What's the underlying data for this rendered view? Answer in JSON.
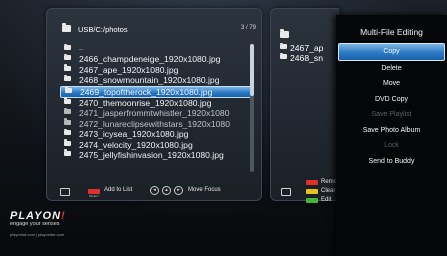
{
  "browser": {
    "path": "USB/C:/photos",
    "page_count": "3 / 79",
    "up_label": "..",
    "files": [
      "2466_champdeneige_1920x1080.jpg",
      "2467_ape_1920x1080.jpg",
      "2468_snowmountain_1920x1080.jpg",
      "2469_topoftherock_1920x1080.jpg",
      "2470_themoonrise_1920x1080.jpg",
      "2471_jasperfrommtwhistler_1920x1080",
      "2472_lunareclipsewithstars_1920x1080",
      "2473_icysea_1920x1080.jpg",
      "2474_velocity_1920x1080.jpg",
      "2475_jellyfishinvasion_1920x1080.jpg"
    ],
    "selected_index": 3
  },
  "right_panel": {
    "files": [
      "2467_ap",
      "2468_sn"
    ]
  },
  "bottom": {
    "add_to_list": "Add to List",
    "move_focus": "Move Focus",
    "right_labels": [
      "Remo",
      "Clear",
      "Edit"
    ],
    "key_small_text": "SELECT"
  },
  "menu": {
    "title": "Multi-File Editing",
    "items": [
      {
        "label": "Copy",
        "state": "selected"
      },
      {
        "label": "Delete",
        "state": "enabled"
      },
      {
        "label": "Move",
        "state": "enabled"
      },
      {
        "label": "DVD Copy",
        "state": "enabled"
      },
      {
        "label": "Save Playlist",
        "state": "disabled"
      },
      {
        "label": "Save Photo Album",
        "state": "enabled"
      },
      {
        "label": "Lock",
        "state": "disabled"
      },
      {
        "label": "Send to Buddy",
        "state": "enabled"
      }
    ]
  },
  "brand": {
    "logo_main": "PLAYON",
    "logo_bang": "!",
    "tagline": "engage your senses",
    "urls": "playonhd.com | playonder.com"
  },
  "colors": {
    "selection": "#2a79c4",
    "red_key": "#e0312d",
    "yellow_key": "#e3c21c",
    "green_key": "#42b63d"
  }
}
